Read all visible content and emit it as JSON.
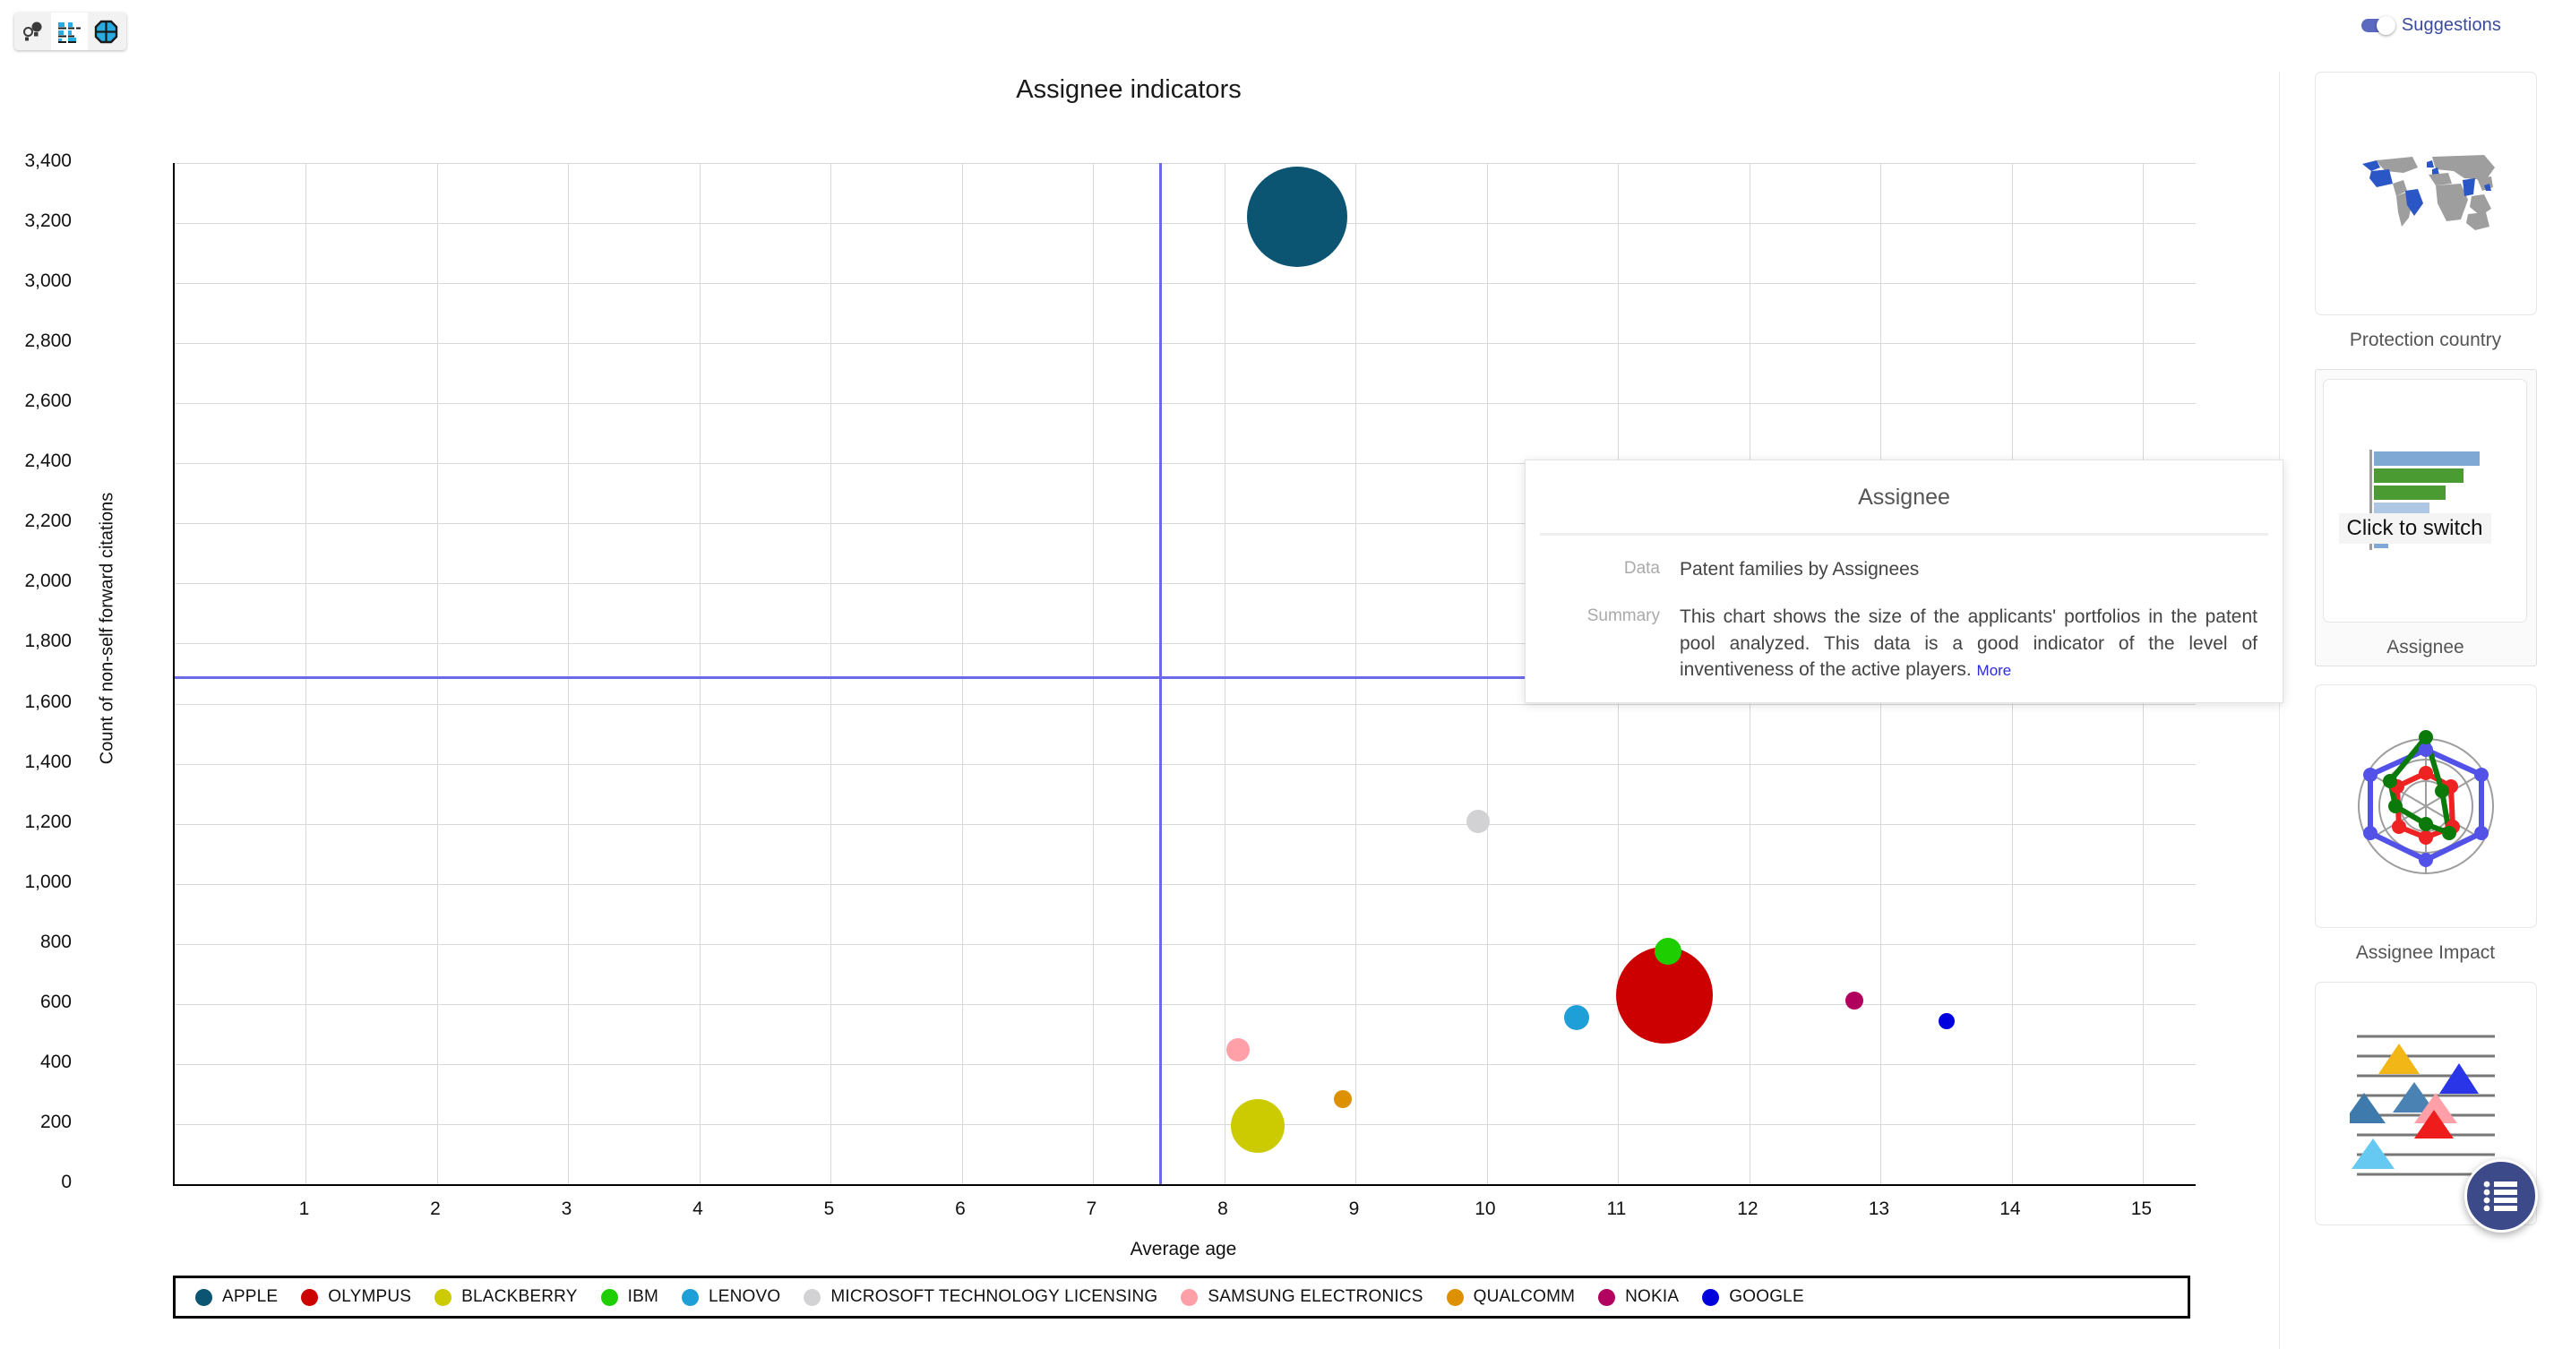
{
  "toolbar": {
    "buttons": [
      {
        "name": "bubble-chart-view",
        "icon": "bubble-chart-icon",
        "active": false
      },
      {
        "name": "bar-chart-view",
        "icon": "bar-chart-icon",
        "active": true
      },
      {
        "name": "radar-chart-view",
        "icon": "radar-chart-icon",
        "active": false
      }
    ]
  },
  "suggestions": {
    "label": "Suggestions",
    "enabled": true,
    "accent": "#5b6abf",
    "cards": [
      {
        "caption": "Protection country",
        "thumb": "world-map-icon",
        "selected": false
      },
      {
        "caption": "Assignee",
        "thumb": "bar-chart-icon",
        "selected": true
      },
      {
        "caption": "Assignee Impact",
        "thumb": "radar-chart-icon",
        "selected": false
      },
      {
        "caption": "",
        "thumb": "scatter-triangles-icon",
        "selected": false
      }
    ],
    "tooltip": "Click to switch",
    "fab_icon": "list-icon"
  },
  "info_popup": {
    "title": "Assignee",
    "data_key": "Data",
    "data_value": "Patent families by Assignees",
    "summary_key": "Summary",
    "summary_value": "This chart shows the size of the applicants' portfolios in the patent pool analyzed. This data is a good indicator of the level of inventiveness of the active players.",
    "more_link": "More"
  },
  "chart_data": {
    "type": "scatter",
    "title": "Assignee indicators",
    "xlabel": "Average age",
    "ylabel": "Count of non-self forward citations",
    "xlim": [
      0,
      15.4
    ],
    "ylim": [
      0,
      3400
    ],
    "xticks": [
      1,
      2,
      3,
      4,
      5,
      6,
      7,
      8,
      9,
      10,
      11,
      12,
      13,
      14,
      15
    ],
    "yticks": [
      0,
      200,
      400,
      600,
      800,
      1000,
      1200,
      1400,
      1600,
      1800,
      2000,
      2200,
      2400,
      2600,
      2800,
      3000,
      3200,
      3400
    ],
    "ytick_labels": [
      "0",
      "200",
      "400",
      "600",
      "800",
      "1,000",
      "1,200",
      "1,400",
      "1,600",
      "1,800",
      "2,000",
      "2,200",
      "2,400",
      "2,600",
      "2,800",
      "3,000",
      "3,200",
      "3,400"
    ],
    "grid": true,
    "legend_position": "bottom",
    "reference_lines": {
      "x": 7.5,
      "y": 1690,
      "color": "#6b6bea"
    },
    "size_metric": "Patent families",
    "points": [
      {
        "name": "APPLE",
        "x": 8.55,
        "y": 3220,
        "r": 56,
        "color": "#0b5472"
      },
      {
        "name": "OLYMPUS",
        "x": 11.35,
        "y": 630,
        "r": 54,
        "color": "#cc0000"
      },
      {
        "name": "BLACKBERRY",
        "x": 8.25,
        "y": 195,
        "r": 30,
        "color": "#ccca00"
      },
      {
        "name": "IBM",
        "x": 11.38,
        "y": 775,
        "r": 15,
        "color": "#1fce00"
      },
      {
        "name": "LENOVO",
        "x": 10.68,
        "y": 555,
        "r": 14,
        "color": "#1f9fd8"
      },
      {
        "name": "MICROSOFT TECHNOLOGY LICENSING",
        "x": 9.93,
        "y": 1208,
        "r": 13,
        "color": "#d2d2d4"
      },
      {
        "name": "SAMSUNG ELECTRONICS",
        "x": 8.1,
        "y": 448,
        "r": 13,
        "color": "#ffa0a8"
      },
      {
        "name": "QUALCOMM",
        "x": 8.9,
        "y": 283,
        "r": 10,
        "color": "#dd9000"
      },
      {
        "name": "NOKIA",
        "x": 12.8,
        "y": 610,
        "r": 10,
        "color": "#b1005e"
      },
      {
        "name": "GOOGLE",
        "x": 13.5,
        "y": 543,
        "r": 9,
        "color": "#0000dd"
      }
    ],
    "legend": [
      {
        "label": "APPLE",
        "color": "#0b5472"
      },
      {
        "label": "OLYMPUS",
        "color": "#cc0000"
      },
      {
        "label": "BLACKBERRY",
        "color": "#ccca00"
      },
      {
        "label": "IBM",
        "color": "#1fce00"
      },
      {
        "label": "LENOVO",
        "color": "#1f9fd8"
      },
      {
        "label": "MICROSOFT TECHNOLOGY LICENSING",
        "color": "#d2d2d4"
      },
      {
        "label": "SAMSUNG ELECTRONICS",
        "color": "#ffa0a8"
      },
      {
        "label": "QUALCOMM",
        "color": "#dd9000"
      },
      {
        "label": "NOKIA",
        "color": "#b1005e"
      },
      {
        "label": "GOOGLE",
        "color": "#0000dd"
      }
    ]
  }
}
